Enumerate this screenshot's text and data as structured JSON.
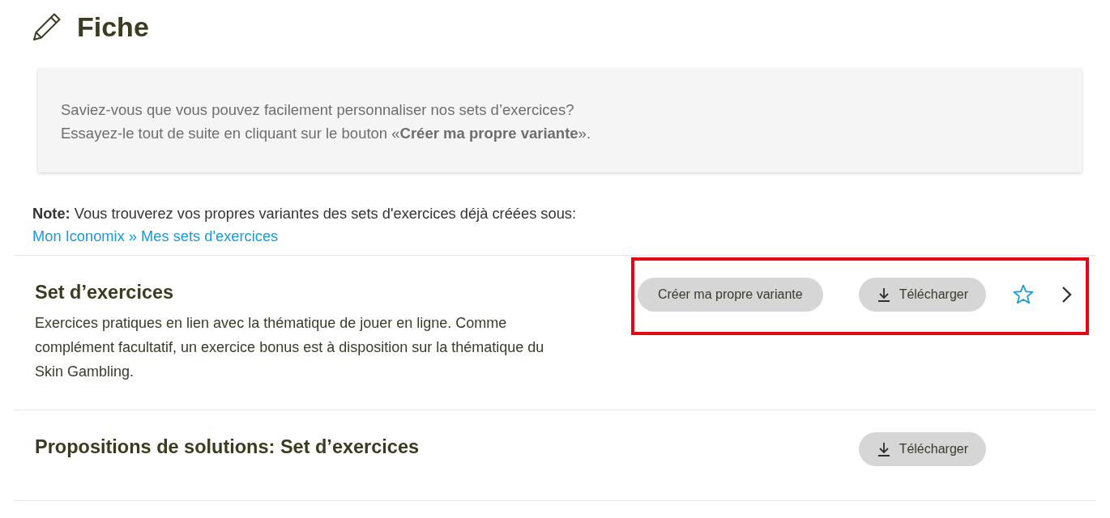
{
  "page": {
    "title": "Fiche"
  },
  "info_box": {
    "lines": [
      "Saviez-vous que vous pouvez facilement personnaliser nos sets d’exercices?",
      "Essayez-le tout de suite en cliquant sur le bouton «**Créer ma propre variante**»."
    ]
  },
  "note": {
    "text": "**Note:** Vous trouverez vos propres variantes des sets d'exercices déjà créées sous:",
    "link": "Mon Iconomix » Mes sets d'exercices"
  },
  "rows": [
    {
      "title": "Set d’exercices",
      "description": "Exercices pratiques en lien avec la thématique de jouer en ligne. Comme complément facultatif, un exercice bonus est à disposition sur la thématique du Skin Gambling.",
      "highlighted": true,
      "buttons": [
        {
          "kind": "variant",
          "label": "Créer ma propre variante"
        },
        {
          "kind": "download",
          "label": "Télécharger"
        }
      ],
      "favorite": false,
      "expandable": true
    },
    {
      "title": "Propositions de solutions: Set d’exercices",
      "highlighted": false,
      "buttons": [
        {
          "kind": "download",
          "label": "Télécharger"
        }
      ],
      "expandable": false
    }
  ]
}
